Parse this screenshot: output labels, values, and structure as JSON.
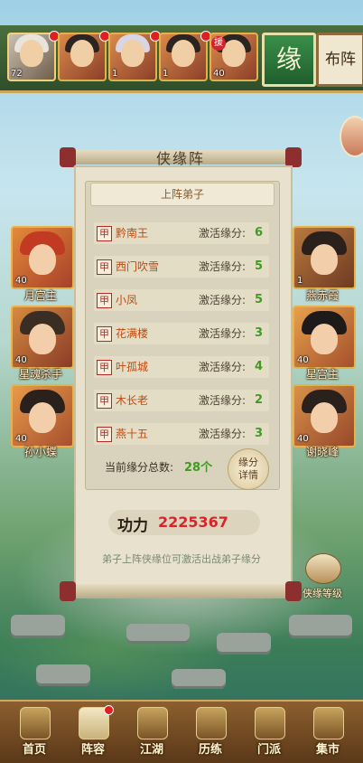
{
  "top_bar": {
    "heroes": [
      {
        "name": "hero-slot-1",
        "level": "72",
        "badge": "",
        "dot": true
      },
      {
        "name": "hero-slot-2",
        "level": "",
        "badge": "",
        "dot": true
      },
      {
        "name": "hero-slot-3",
        "level": "1",
        "badge": "",
        "dot": true
      },
      {
        "name": "hero-slot-4",
        "level": "1",
        "badge": "",
        "dot": true
      },
      {
        "name": "hero-slot-5",
        "level": "40",
        "badge": "援",
        "dot": false
      }
    ],
    "yuan_label": "缘",
    "buzhen_label": "布阵"
  },
  "left_heroes": [
    {
      "name": "月宫主",
      "level": "40"
    },
    {
      "name": "星魂杀手",
      "level": "40"
    },
    {
      "name": "孙小蝶",
      "level": "40"
    }
  ],
  "right_heroes": [
    {
      "name": "燕赤霞",
      "level": "1"
    },
    {
      "name": "星宫主",
      "level": "40"
    },
    {
      "name": "谢晓峰",
      "level": "40"
    }
  ],
  "panel": {
    "title": "侠缘阵",
    "section_title": "上阵弟子",
    "stamp": "甲",
    "activate_label": "激活缘分:",
    "rows": [
      {
        "name": "黔南王",
        "value": "6"
      },
      {
        "name": "西门吹雪",
        "value": "5"
      },
      {
        "name": "小凤",
        "value": "5"
      },
      {
        "name": "花满楼",
        "value": "3"
      },
      {
        "name": "叶孤城",
        "value": "4"
      },
      {
        "name": "木长老",
        "value": "2"
      },
      {
        "name": "燕十五",
        "value": "3"
      }
    ],
    "total_label": "当前缘分总数:",
    "total_value": "28个",
    "detail_button": "缘分详情",
    "power_label": "功力",
    "power_value": "2225367",
    "hint": "弟子上阵侠缘位可激活出战弟子缘分"
  },
  "xiayuan_level_button": "侠缘等级",
  "bottom_nav": [
    {
      "label": "首页",
      "active": false,
      "dot": false
    },
    {
      "label": "阵容",
      "active": true,
      "dot": true
    },
    {
      "label": "江湖",
      "active": false,
      "dot": false
    },
    {
      "label": "历练",
      "active": false,
      "dot": false
    },
    {
      "label": "门派",
      "active": false,
      "dot": false
    },
    {
      "label": "集市",
      "active": false,
      "dot": false
    }
  ]
}
